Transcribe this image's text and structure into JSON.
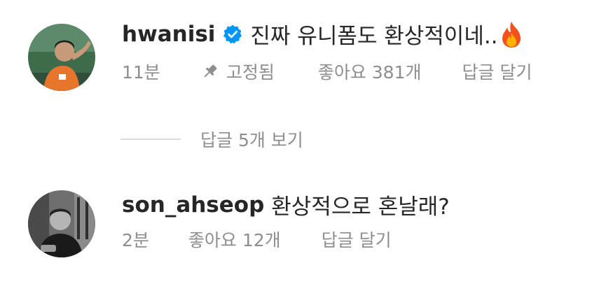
{
  "comments": [
    {
      "username": "hwanisi",
      "verified": true,
      "text": "진짜 유니폼도 환상적이네..",
      "emoji_icon": "fire-icon",
      "time": "11분",
      "pinned_label": "고정됨",
      "likes": "좋아요 381개",
      "reply_label": "답글 달기"
    },
    {
      "username": "son_ahseop",
      "verified": false,
      "text": "환상적으로 혼날래?",
      "time": "2분",
      "likes": "좋아요 12개",
      "reply_label": "답글 달기"
    }
  ],
  "view_replies_label": "답글 5개 보기",
  "colors": {
    "text": "#262626",
    "secondary": "#8e8e8e",
    "verified": "#0095f6",
    "divider": "#dbdbdb"
  }
}
